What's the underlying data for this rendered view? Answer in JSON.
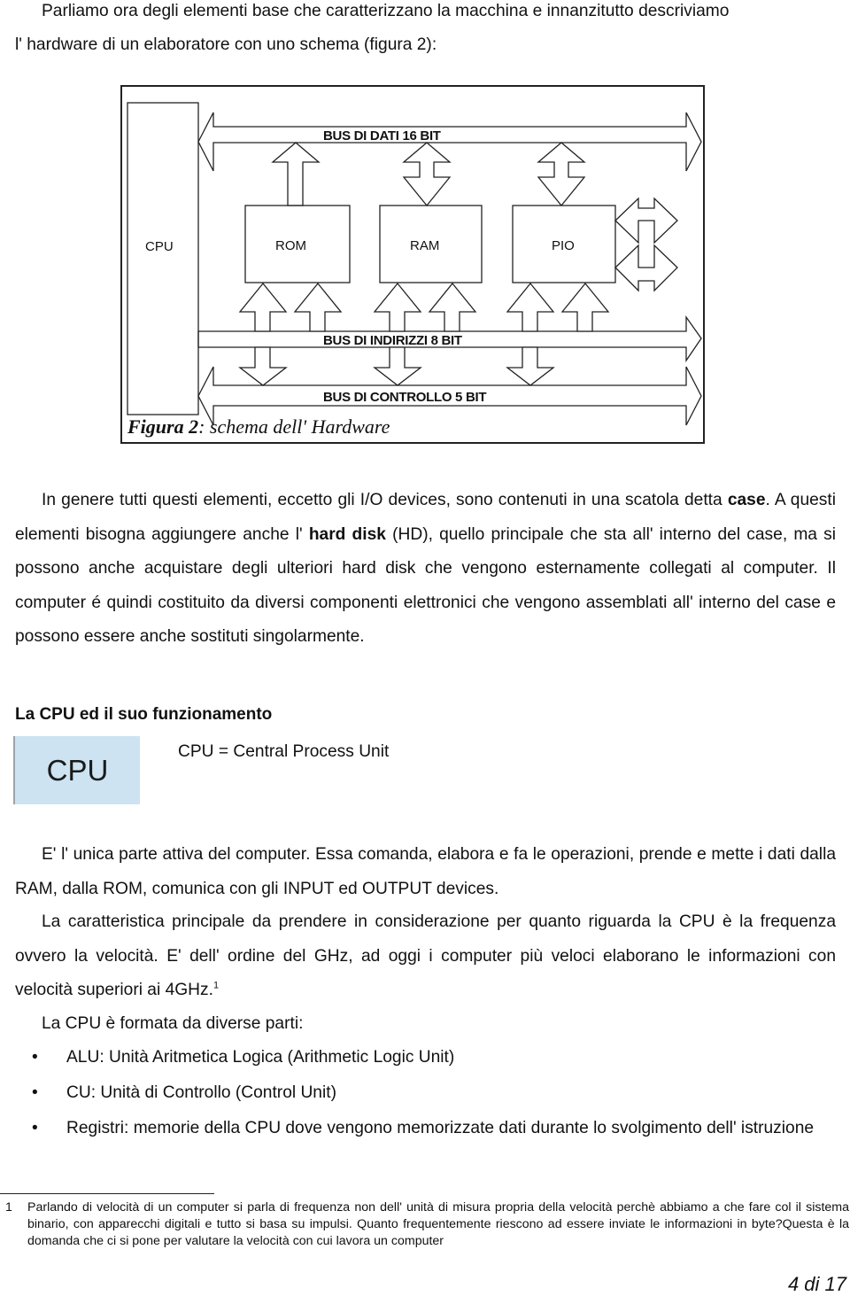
{
  "intro": {
    "line1": "Parliamo ora degli elementi base che caratterizzano la macchina e innanzitutto descriviamo",
    "line2": "l' hardware di un elaboratore con uno schema (figura 2):"
  },
  "figure": {
    "caption_bold": "Figura 2",
    "caption_rest": ": schema dell' Hardware",
    "blocks": {
      "cpu": "CPU",
      "rom": "ROM",
      "ram": "RAM",
      "pio": "PIO"
    },
    "buses": {
      "data": "BUS DI DATI 16 BIT",
      "address": "BUS DI INDIRIZZI 8  BIT",
      "control": "BUS DI CONTROLLO 5 BIT"
    }
  },
  "paragraph_case": {
    "part1": "In genere tutti questi elementi, eccetto gli I/O devices, sono contenuti in una scatola detta ",
    "bold_case": "case",
    "part2": ". A questi elementi bisogna aggiungere anche l' ",
    "bold_hd": "hard disk",
    "part3": " (HD), quello principale che sta all' interno del case, ma si possono anche acquistare degli ulteriori hard disk che vengono esternamente collegati al computer. Il computer é quindi  costituito da diversi componenti elettronici che vengono assemblati all' interno del case e possono essere anche sostituti singolarmente."
  },
  "section": {
    "heading": "La CPU ed il suo funzionamento",
    "cpu_image_label": "CPU",
    "cpu_definition": "CPU = Central Process Unit"
  },
  "paragraph_active": "E' l' unica parte attiva del computer. Essa comanda, elabora e fa le operazioni, prende e mette i dati dalla RAM, dalla ROM, comunica con gli INPUT ed OUTPUT devices.",
  "paragraph_frequency": {
    "text": "La caratteristica principale da prendere in considerazione per quanto riguarda la CPU è la frequenza ovvero la velocità. E' dell' ordine del GHz, ad oggi i computer più veloci elaborano le informazioni con velocità superiori ai 4GHz.",
    "footnote_ref": "1"
  },
  "parts": {
    "intro": "La CPU è formata da diverse parti:",
    "bullet": "•",
    "items": [
      "ALU: Unità Aritmetica Logica (Arithmetic Logic Unit)",
      "CU: Unità di Controllo (Control Unit)",
      "Registri: memorie della CPU dove vengono memorizzate dati durante lo svolgimento dell' istruzione"
    ]
  },
  "footnote": {
    "number": "1",
    "text": "Parlando di velocità di un computer si parla di frequenza non dell' unità di misura propria della velocità perchè abbiamo a che fare col il sistema binario, con apparecchi digitali e tutto si basa su impulsi. Quanto frequentemente riescono ad essere inviate le informazioni in byte?Questa è la domanda che ci si pone per valutare la velocità con cui lavora un computer"
  },
  "page_number": "4 di 17"
}
